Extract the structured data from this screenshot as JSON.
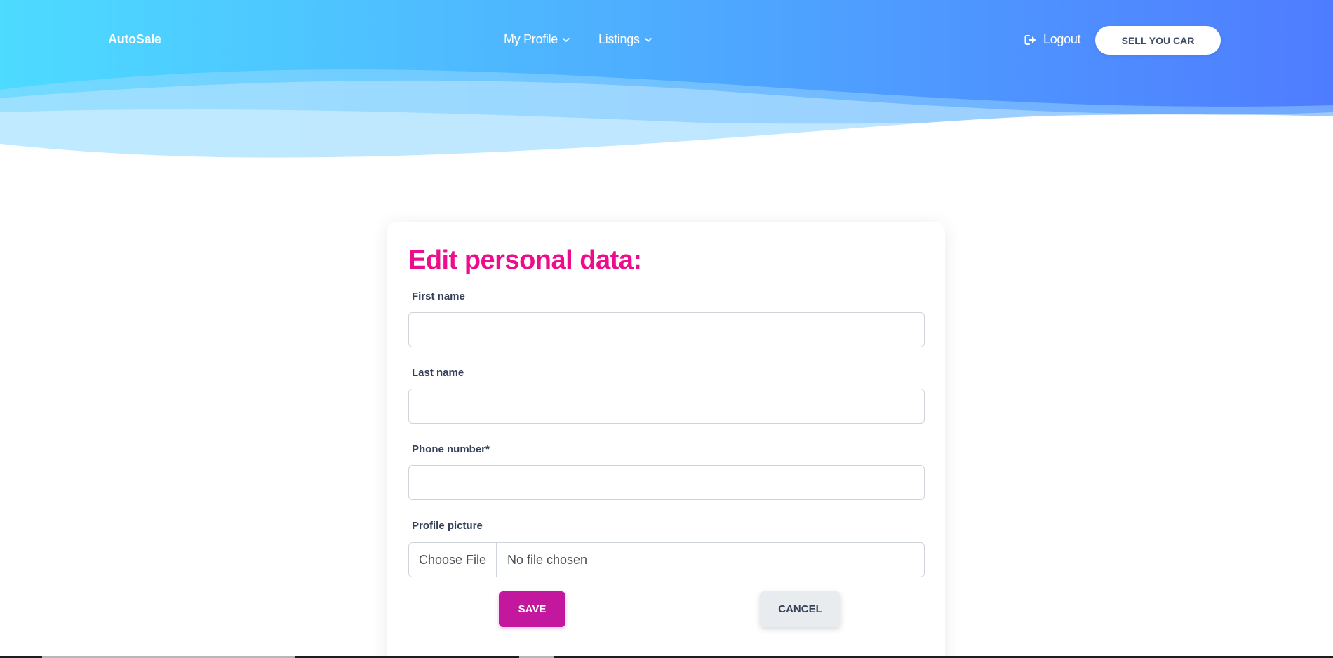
{
  "colors": {
    "banner_left": "#4ddbff",
    "banner_right": "#4f7cff",
    "title_pink": "#ec0c8c",
    "save_magenta": "#c3179e",
    "cancel_gray": "#e9ecef"
  },
  "navbar": {
    "brand": "AutoSale",
    "menu": [
      {
        "label": "My Profile",
        "icon": "chevron-down-icon"
      },
      {
        "label": "Listings",
        "icon": "chevron-down-icon"
      }
    ],
    "logout": {
      "label": "Logout",
      "icon": "sign-out-icon"
    },
    "cta_label": "SELL YOU CAR"
  },
  "form": {
    "title": "Edit personal data:",
    "fields": [
      {
        "label": "First name",
        "value": ""
      },
      {
        "label": "Last name",
        "value": ""
      },
      {
        "label": "Phone number*",
        "value": ""
      }
    ],
    "profile_picture": {
      "label": "Profile picture",
      "button_label": "Choose File",
      "status": "No file chosen"
    },
    "save_label": "SAVE",
    "cancel_label": "CANCEL"
  }
}
